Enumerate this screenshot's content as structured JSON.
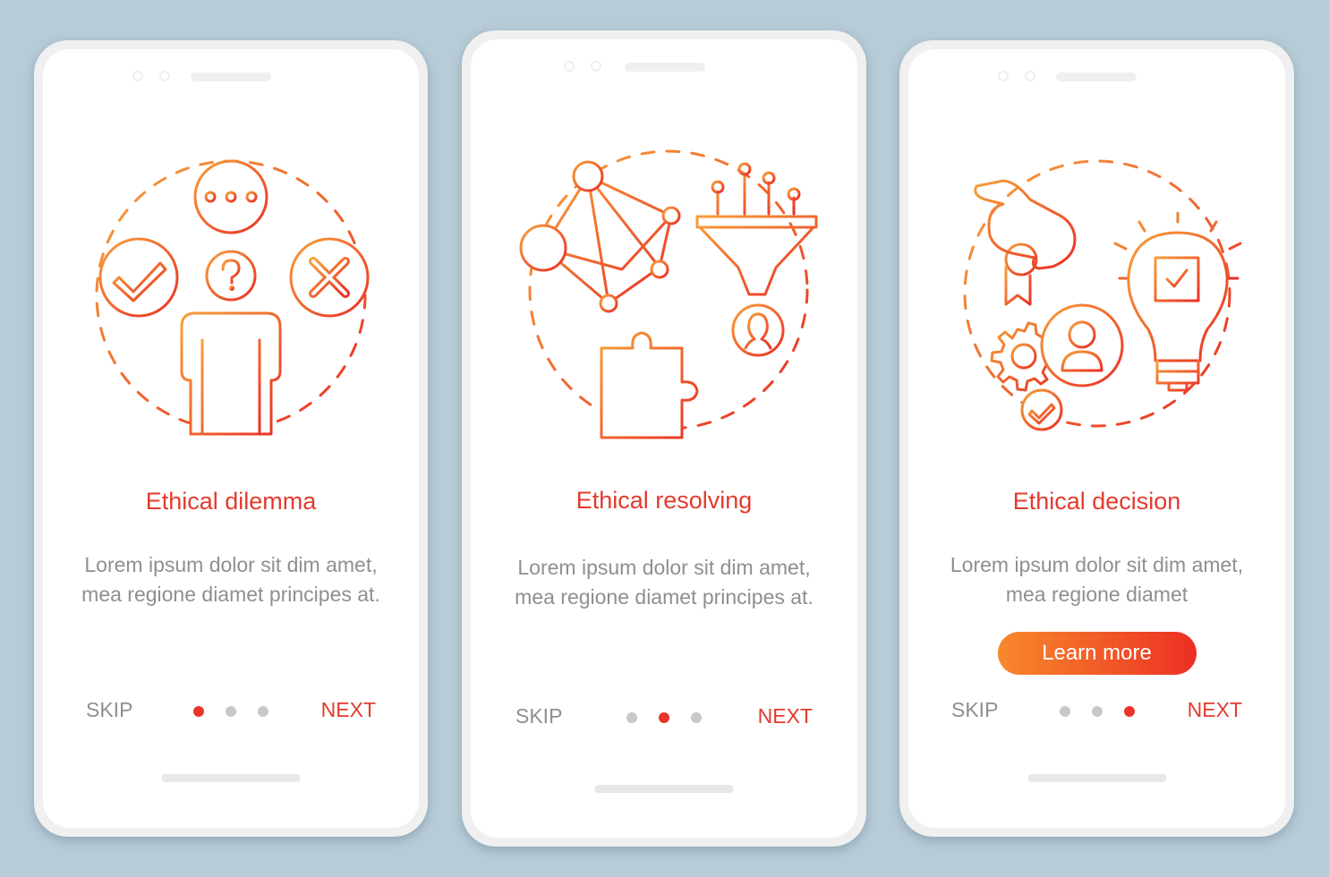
{
  "theme": {
    "background": "#b8ccd8",
    "accent": "#e23b2e",
    "gradient_start": "#f7892c",
    "gradient_end": "#ec2f23",
    "text_muted": "#8f8f8f",
    "dot_inactive": "#c8c8c8",
    "dot_active": "#e8352a"
  },
  "screens": [
    {
      "illustration": "ethical-dilemma-illustration",
      "icons": [
        "person-icon",
        "question-mark-icon",
        "speech-bubble-dots-icon",
        "checkmark-circle-icon",
        "cross-circle-icon"
      ],
      "title": "Ethical dilemma",
      "description": "Lorem ipsum dolor sit dim amet, mea regione diamet principes at.",
      "skip_label": "SKIP",
      "next_label": "NEXT",
      "active_page": 1,
      "total_pages": 3
    },
    {
      "illustration": "ethical-resolving-illustration",
      "icons": [
        "network-nodes-icon",
        "funnel-icon",
        "puzzle-piece-icon",
        "user-circle-icon"
      ],
      "title": "Ethical resolving",
      "description": "Lorem ipsum dolor sit dim amet, mea regione diamet principes at.",
      "skip_label": "SKIP",
      "next_label": "NEXT",
      "active_page": 2,
      "total_pages": 3
    },
    {
      "illustration": "ethical-decision-illustration",
      "icons": [
        "hand-with-medal-icon",
        "lightbulb-check-icon",
        "gear-icon",
        "user-circle-icon",
        "checkmark-circle-icon"
      ],
      "title": "Ethical decision",
      "description": "Lorem ipsum dolor sit dim amet, mea regione diamet",
      "cta_label": "Learn more",
      "skip_label": "SKIP",
      "next_label": "NEXT",
      "active_page": 3,
      "total_pages": 3
    }
  ]
}
